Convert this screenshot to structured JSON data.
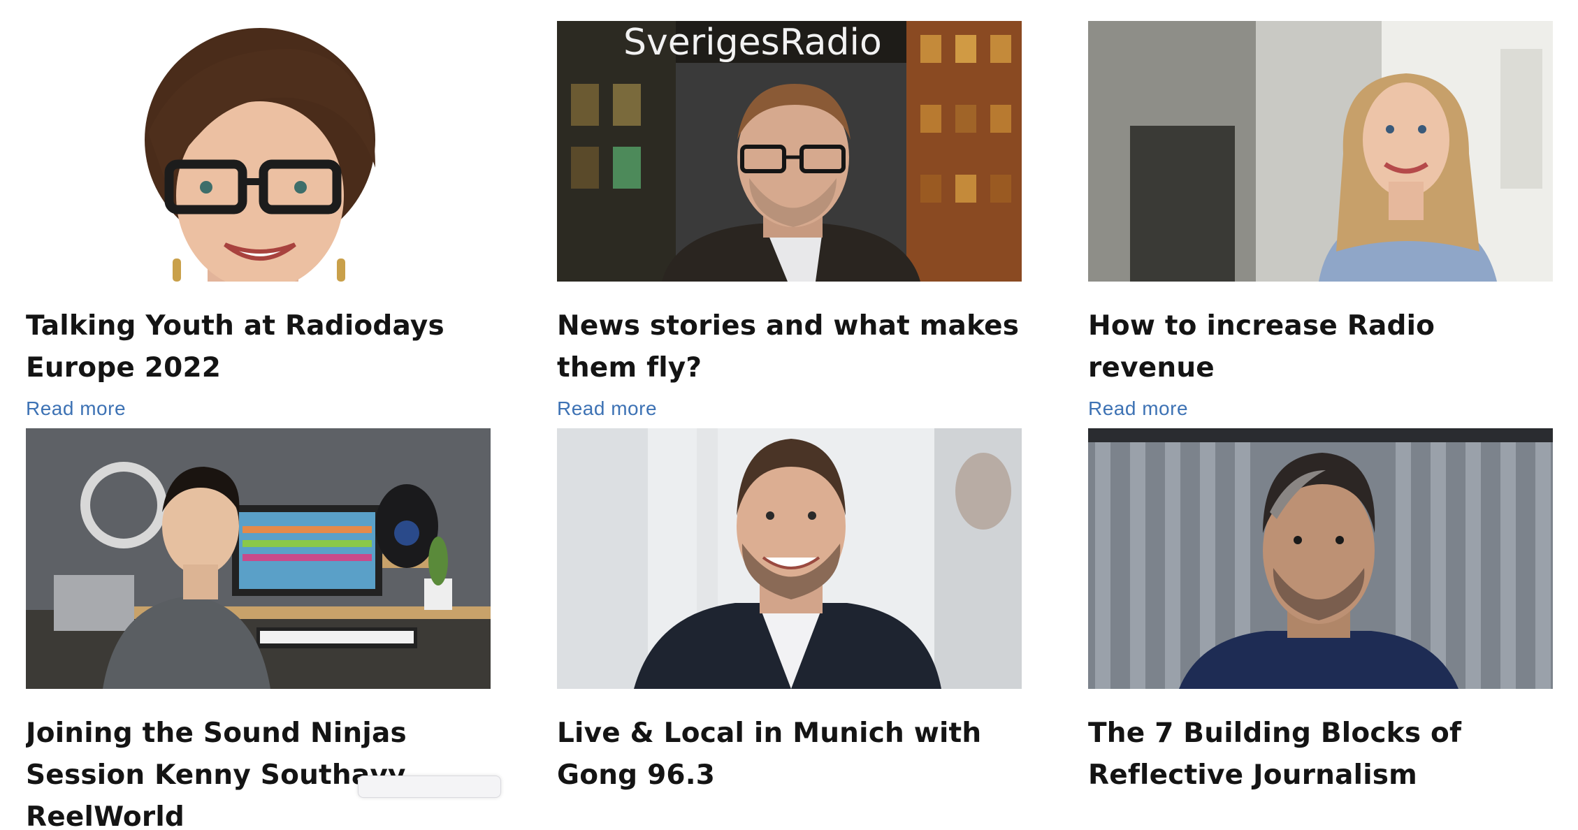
{
  "articles": [
    {
      "title": "Talking Youth at Radiodays Europe 2022",
      "link_label": "Read more",
      "image": "portrait-woman-glasses-short-hair"
    },
    {
      "title": "News stories and what makes them fly?",
      "link_label": "Read more",
      "image": "portrait-man-glasses-sveriges-radio-building"
    },
    {
      "title": "How to increase Radio revenue",
      "link_label": "Read more",
      "image": "portrait-woman-blonde-office"
    },
    {
      "title": "Joining the Sound Ninjas Session Kenny Southavy, ReelWorld",
      "link_label": "",
      "image": "man-in-music-studio"
    },
    {
      "title": "Live & Local in Munich with Gong 96.3",
      "link_label": "",
      "image": "portrait-man-suit-smiling"
    },
    {
      "title": "The 7 Building Blocks of Reflective Journalism",
      "link_label": "",
      "image": "portrait-man-corrugated-wall"
    }
  ],
  "building_sign": "SverigesRadio",
  "colors": {
    "link": "#3d72b4",
    "title": "#141414",
    "background": "#ffffff"
  }
}
